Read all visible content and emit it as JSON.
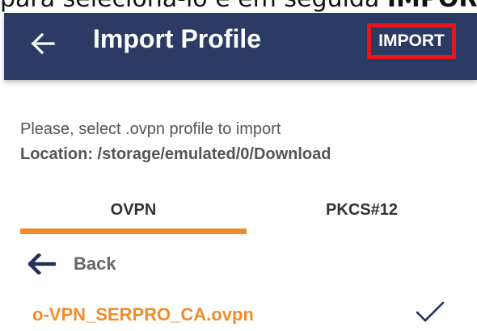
{
  "caption": {
    "text_prefix": "para seleciona-lo e em seguida ",
    "text_bold": "IMPORT"
  },
  "appbar": {
    "title": "Import Profile",
    "import_label": "IMPORT",
    "background": "#2b3b63",
    "highlight_color": "#e8141b"
  },
  "content": {
    "instruction": "Please, select .ovpn profile to import",
    "location": "Location: /storage/emulated/0/Download"
  },
  "tabs": [
    {
      "label": "OVPN",
      "selected": true
    },
    {
      "label": "PKCS#12",
      "selected": false
    }
  ],
  "accent_color": "#f18c2c",
  "list": {
    "back_label": "Back",
    "back_icon": "arrow-left-icon",
    "files": [
      {
        "name": "o-VPN_SERPRO_CA.ovpn",
        "checked": true,
        "icon": "check-icon"
      }
    ]
  }
}
